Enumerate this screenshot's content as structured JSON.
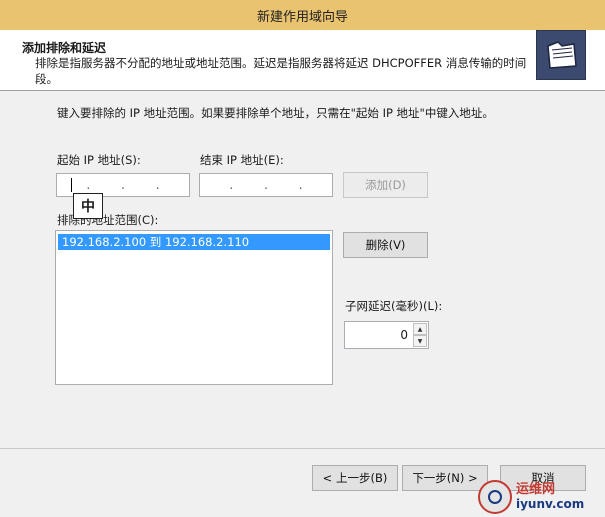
{
  "window": {
    "title": "新建作用域向导"
  },
  "header": {
    "title": "添加排除和延迟",
    "description": "排除是指服务器不分配的地址或地址范围。延迟是指服务器将延迟 DHCPOFFER 消息传输的时间段。"
  },
  "instruction": "键入要排除的 IP 地址范围。如果要排除单个地址，只需在\"起始 IP 地址\"中键入地址。",
  "start_ip": {
    "label": "起始 IP 地址(S):",
    "value": ""
  },
  "end_ip": {
    "label": "结束 IP 地址(E):",
    "value": ""
  },
  "add_button": "添加(D)",
  "excluded_list": {
    "label": "排除的地址范围(C):",
    "items": [
      "192.168.2.100 到 192.168.2.110"
    ]
  },
  "remove_button": "删除(V)",
  "subnet_delay": {
    "label": "子网延迟(毫秒)(L):",
    "value": "0"
  },
  "ime_indicator": "中",
  "nav": {
    "back": "< 上一步(B)",
    "next": "下一步(N) >",
    "cancel": "取消"
  },
  "watermark": {
    "line1": "运维网",
    "line2": "iyunv.com"
  },
  "colors": {
    "title_bar": "#e9c36f",
    "selection": "#3399ff",
    "header_bg": "#ffffff"
  }
}
